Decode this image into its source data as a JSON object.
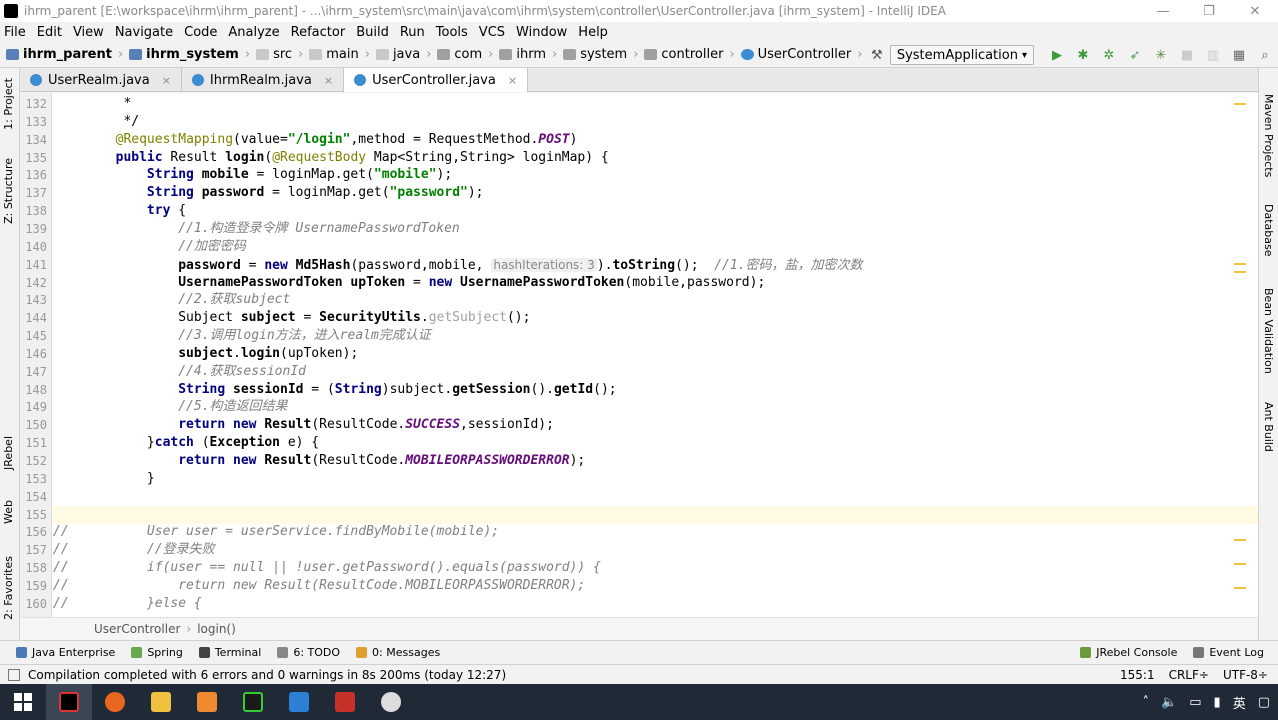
{
  "window": {
    "title": "ihrm_parent [E:\\workspace\\ihrm\\ihrm_parent] - ...\\ihrm_system\\src\\main\\java\\com\\ihrm\\system\\controller\\UserController.java [ihrm_system] - IntelliJ IDEA",
    "minimize": "—",
    "maximize": "❐",
    "close": "✕"
  },
  "menu": [
    "File",
    "Edit",
    "View",
    "Navigate",
    "Code",
    "Analyze",
    "Refactor",
    "Build",
    "Run",
    "Tools",
    "VCS",
    "Window",
    "Help"
  ],
  "breadcrumbs": [
    {
      "label": "ihrm_parent",
      "bold": true,
      "icon": "module-icon"
    },
    {
      "label": "ihrm_system",
      "bold": true,
      "icon": "module-icon"
    },
    {
      "label": "src",
      "icon": "folder-icon"
    },
    {
      "label": "main",
      "icon": "folder-icon"
    },
    {
      "label": "java",
      "icon": "folder-icon"
    },
    {
      "label": "com",
      "icon": "package-icon"
    },
    {
      "label": "ihrm",
      "icon": "package-icon"
    },
    {
      "label": "system",
      "icon": "package-icon"
    },
    {
      "label": "controller",
      "icon": "package-icon"
    },
    {
      "label": "UserController",
      "icon": "class-icon"
    }
  ],
  "run_config": "SystemApplication",
  "tabs": [
    {
      "label": "UserRealm.java",
      "active": false
    },
    {
      "label": "IhrmRealm.java",
      "active": false
    },
    {
      "label": "UserController.java",
      "active": true
    }
  ],
  "left_tools": [
    "1: Project",
    "Z: Structure",
    "JRebel",
    "Web",
    "2: Favorites"
  ],
  "right_tools": [
    "Maven Projects",
    "Database",
    "Bean Validation",
    "Ant Build"
  ],
  "code_lines": [
    {
      "n": "132",
      "html": "         *"
    },
    {
      "n": "133",
      "html": "         */"
    },
    {
      "n": "134",
      "html": "        <span class='ann'>@RequestMapping</span>(value=<span class='str'>\"/login\"</span>,method = RequestMethod.<span class='stat'>POST</span>)"
    },
    {
      "n": "135",
      "html": "        <span class='kw'>public</span> Result <b>login</b>(<span class='ann'>@RequestBody</span> Map&lt;String,String&gt; loginMap) {"
    },
    {
      "n": "136",
      "html": "            <span class='kw'>String</span> <b>mobile</b> = loginMap.get(<span class='str'>\"mobile\"</span>);"
    },
    {
      "n": "137",
      "html": "            <span class='kw'>String</span> <b>password</b> = loginMap.get(<span class='str'>\"password\"</span>);"
    },
    {
      "n": "138",
      "html": "            <span class='kw'>try</span> {"
    },
    {
      "n": "139",
      "html": "                <span class='cm'>//1.构造登录令牌 UsernamePasswordToken</span>"
    },
    {
      "n": "140",
      "html": "                <span class='cm'>//加密密码</span>"
    },
    {
      "n": "141",
      "html": "                <b>password</b> = <span class='kw'>new</span> <b>Md5Hash</b>(password,mobile, <span class='hint'>hashIterations: 3</span>).<b>toString</b>();  <span class='cm'>//1.密码，盐，加密次数</span>"
    },
    {
      "n": "142",
      "html": "                <b>UsernamePasswordToken upToken</b> = <span class='kw'>new</span> <b>UsernamePasswordToken</b>(mobile,password);"
    },
    {
      "n": "143",
      "html": "                <span class='cm'>//2.获取subject</span>"
    },
    {
      "n": "144",
      "html": "                Subject <b>subject</b> = <b>SecurityUtils</b>.<span class='dim'>getSubject</span>();"
    },
    {
      "n": "145",
      "html": "                <span class='cm'>//3.调用login方法，进入realm完成认证</span>"
    },
    {
      "n": "146",
      "html": "                <b>subject</b>.<b>login</b>(upToken);"
    },
    {
      "n": "147",
      "html": "                <span class='cm'>//4.获取sessionId</span>"
    },
    {
      "n": "148",
      "html": "                <span class='kw'>String</span> <b>sessionId</b> = (<span class='kw'>String</span>)subject.<b>getSession</b>().<b>getId</b>();"
    },
    {
      "n": "149",
      "html": "                <span class='cm'>//5.构造返回结果</span>"
    },
    {
      "n": "150",
      "html": "                <span class='kw'>return</span> <span class='kw'>new</span> <b>Result</b>(ResultCode.<span class='stat'>SUCCESS</span>,sessionId);"
    },
    {
      "n": "151",
      "html": "            }<span class='kw'>catch</span> (<b>Exception</b> e) {"
    },
    {
      "n": "152",
      "html": "                <span class='kw'>return</span> <span class='kw'>new</span> <b>Result</b>(ResultCode.<span class='stat'>MOBILEORPASSWORDERROR</span>);"
    },
    {
      "n": "153",
      "html": "            }"
    },
    {
      "n": "154",
      "html": ""
    },
    {
      "n": "155",
      "html": ""
    },
    {
      "n": "156",
      "html": "<span class='cm'>//          User user = userService.findByMobile(mobile);</span>"
    },
    {
      "n": "157",
      "html": "<span class='cm'>//          //登录失败</span>"
    },
    {
      "n": "158",
      "html": "<span class='cm'>//          if(user == null || !user.getPassword().equals(password)) {</span>"
    },
    {
      "n": "159",
      "html": "<span class='cm'>//              return new Result(ResultCode.MOBILEORPASSWORDERROR);</span>"
    },
    {
      "n": "160",
      "html": "<span class='cm'>//          }else {</span>"
    }
  ],
  "caret_line": "155",
  "editor_crumb": {
    "class": "UserController",
    "method": "login()"
  },
  "tool_windows": [
    {
      "label": "Java Enterprise",
      "icon": "java-enterprise-icon"
    },
    {
      "label": "Spring",
      "icon": "spring-icon"
    },
    {
      "label": "Terminal",
      "icon": "terminal-icon"
    },
    {
      "label": "6: TODO",
      "icon": "todo-icon"
    },
    {
      "label": "0: Messages",
      "icon": "messages-icon"
    }
  ],
  "tool_windows_right": [
    {
      "label": "JRebel Console",
      "icon": "jrebel-icon"
    },
    {
      "label": "Event Log",
      "icon": "event-log-icon"
    }
  ],
  "status": {
    "message": "Compilation completed with 6 errors and 0 warnings in 8s 200ms (today 12:27)",
    "position": "155:1",
    "line_sep": "CRLF÷",
    "encoding": "UTF-8÷"
  },
  "taskbar": {
    "apps": [
      "start-icon",
      "intellij-icon",
      "firefox-icon",
      "explorer-icon",
      "sublime-icon",
      "terminal-icon",
      "monitor-icon",
      "redis-icon",
      "chrome-icon"
    ],
    "tray_lang": "英"
  },
  "colors": {
    "keyword": "#000080",
    "string": "#008000",
    "comment": "#808080",
    "annotation": "#808000",
    "static": "#660e7a",
    "caret_line": "#fffae3"
  }
}
